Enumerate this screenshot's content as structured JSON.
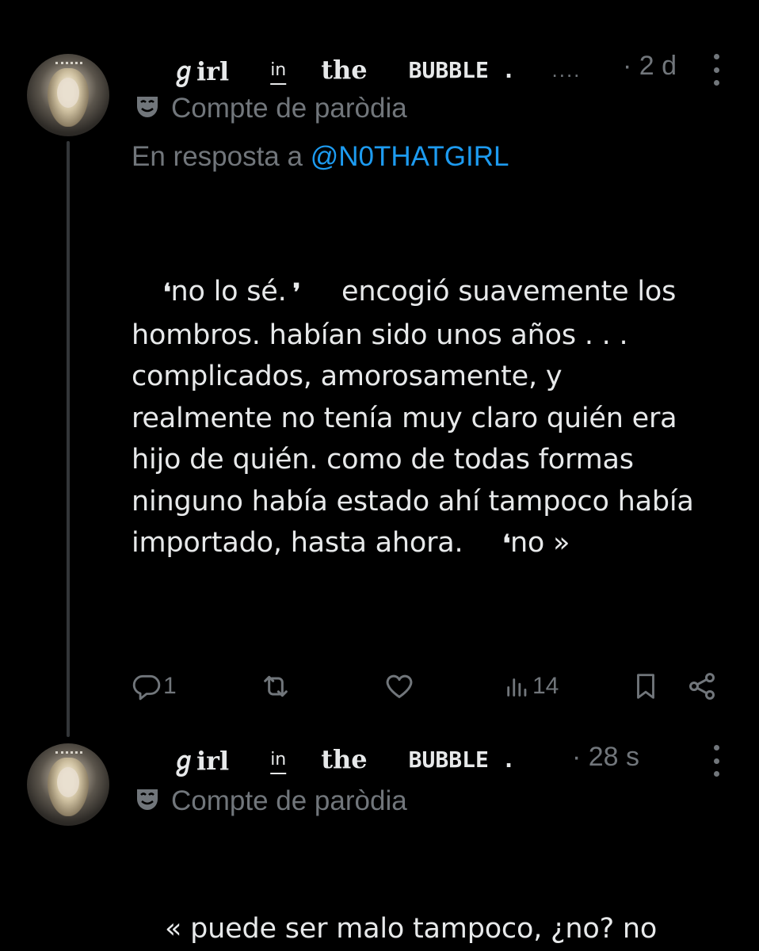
{
  "tweet1": {
    "name": {
      "p1": "ℊirl",
      "p2": "in",
      "p3": "the",
      "p4": "BUBBLE .",
      "p5": "...."
    },
    "time": "· 2 d",
    "parody_label": "Compte de paròdia",
    "reply_prefix": "En resposta a",
    "reply_handle": "@N0THATGIRL",
    "body": {
      "l1a": "no lo sé.",
      "l1b": "encogió suavemente los",
      "l2": "hombros. habían sido unos años . . .",
      "l3": "complicados, amorosamente, y",
      "l4": "realmente no tenía muy claro quién era",
      "l5": "hijo de quién. como de todas formas",
      "l6": "ninguno había estado ahí tampoco había",
      "l7a": "importado, hasta ahora.",
      "l7b": "no »"
    },
    "actions": {
      "replies": "1",
      "views": "14"
    }
  },
  "tweet2": {
    "name": {
      "p1": "ℊirl",
      "p2": "in",
      "p3": "the",
      "p4": "BUBBLE ."
    },
    "time": "· 28 s",
    "parody_label": "Compte de paròdia",
    "body": {
      "l1": "« puede ser malo tampoco, ¿no? no"
    }
  },
  "icons": [
    "mask-icon",
    "reply-icon",
    "retweet-icon",
    "like-icon",
    "views-icon",
    "bookmark-icon",
    "share-icon",
    "more-icon"
  ],
  "colors": {
    "background": "#000000",
    "text": "#e7e9ea",
    "muted": "#71767b",
    "link": "#1d9bf0",
    "thread_line": "#333639"
  }
}
